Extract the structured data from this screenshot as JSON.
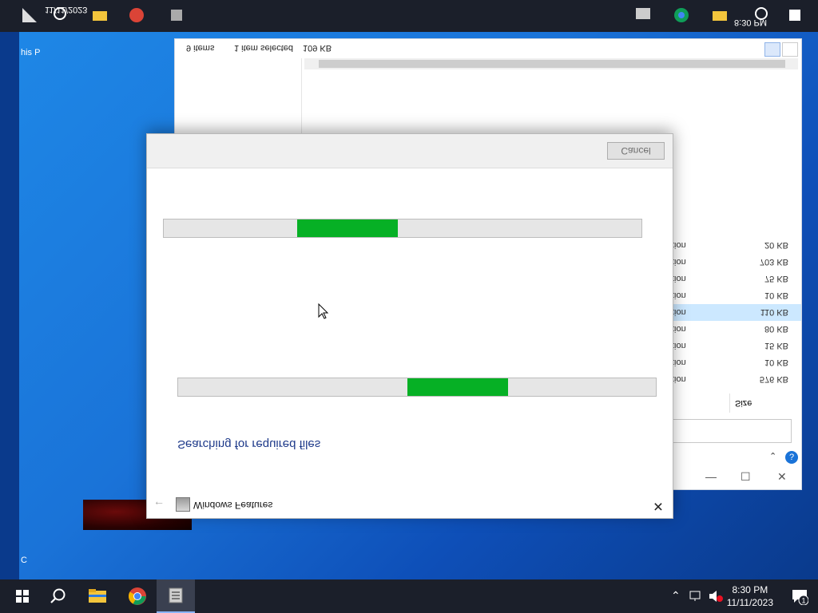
{
  "top_strip": {
    "date": "11/11/2023",
    "time": "8:30 PM"
  },
  "desktop": {
    "label_top": "his P",
    "label_bottom": "C"
  },
  "explorer": {
    "status_items": "9 items",
    "status_selected": "1 item selected",
    "status_size": "109 KB",
    "size_header": "Size",
    "rows": [
      {
        "type": "tion",
        "size": "20 KB",
        "selected": false
      },
      {
        "type": "tion",
        "size": "703 KB",
        "selected": false
      },
      {
        "type": "tion",
        "size": "75 KB",
        "selected": false
      },
      {
        "type": "tion",
        "size": "10 KB",
        "selected": false
      },
      {
        "type": "tion",
        "size": "110 KB",
        "selected": true
      },
      {
        "type": "tion",
        "size": "80 KB",
        "selected": false
      },
      {
        "type": "tion",
        "size": "15 KB",
        "selected": false
      },
      {
        "type": "tion",
        "size": "10 KB",
        "selected": false
      },
      {
        "type": "tion",
        "size": "576 KB",
        "selected": false
      }
    ],
    "help": "?"
  },
  "dialog": {
    "title": "Windows Features",
    "status": "Searching for required files",
    "cancel_label": "Cancel",
    "progress1_fraction": 0.21,
    "progress2_fraction": 0.21
  },
  "taskbar": {
    "time": "8:30 PM",
    "date": "11/11/2023",
    "notifications": "1"
  },
  "colors": {
    "progress_green": "#06b025",
    "status_blue": "#1e3a8a",
    "taskbar": "#1b1f2a"
  }
}
